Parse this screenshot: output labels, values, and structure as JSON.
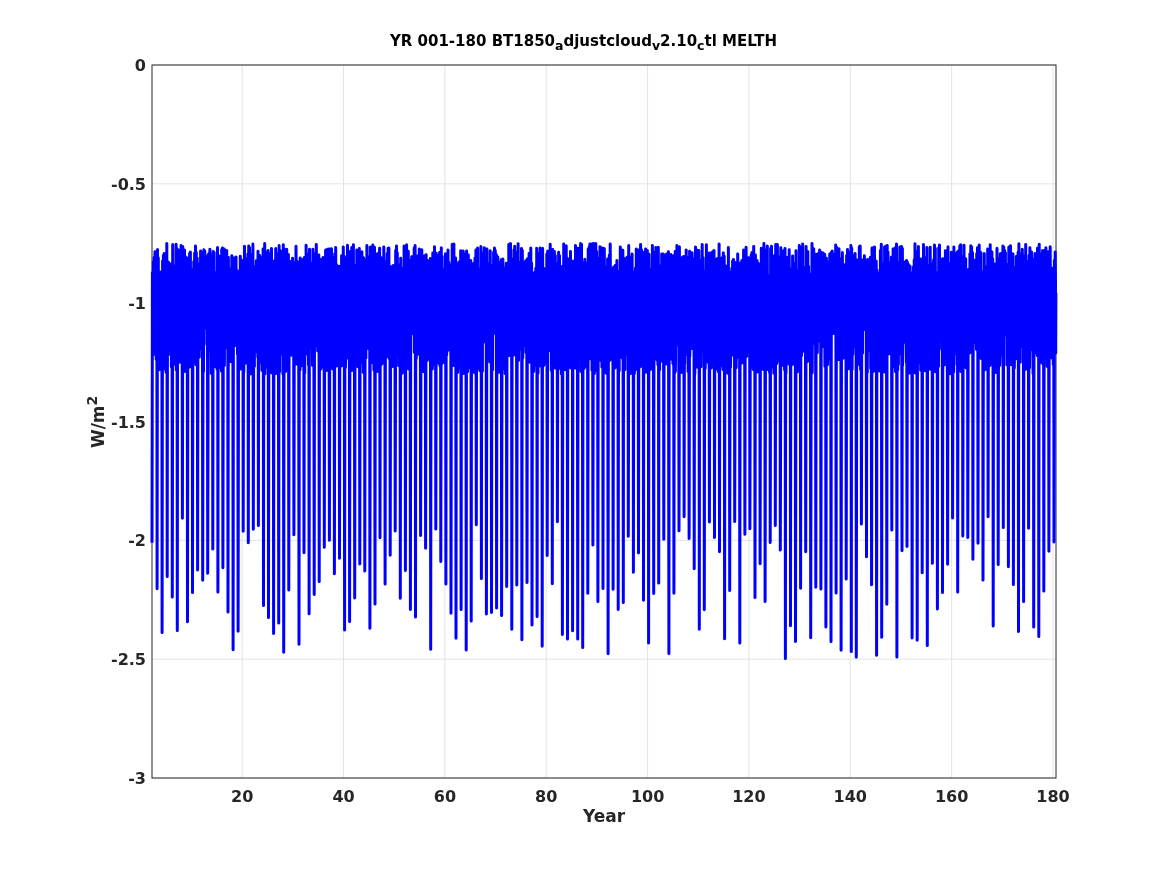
{
  "figure": {
    "chart_data": {
      "type": "line",
      "grid": true,
      "title": "YR 001-180 BT1850$_{a}$djustcloud$_{v}$2.10$_{c}$tl MELTH",
      "xlabel": "Year",
      "ylabel": "W/m$^{2}$",
      "xlim": [
        2.2,
        180.6
      ],
      "ylim": [
        -3,
        0
      ],
      "xticks": [
        20,
        40,
        60,
        80,
        100,
        120,
        140,
        160,
        180
      ],
      "yticks": [
        -3,
        -2.5,
        -2,
        -1.5,
        -1,
        -0.5,
        0
      ]
    }
  }
}
